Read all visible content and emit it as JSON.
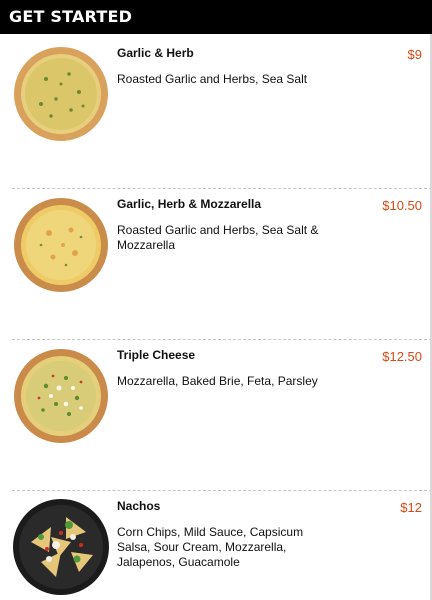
{
  "header": {
    "title": "GET STARTED"
  },
  "items": [
    {
      "name": "Garlic & Herb",
      "price": "$9",
      "description": "Roasted Garlic and Herbs, Sea Salt",
      "image_icon": "garlic-herb-pizza-icon"
    },
    {
      "name": "Garlic, Herb & Mozzarella",
      "price": "$10.50",
      "description": "Roasted Garlic and Herbs, Sea Salt & Mozzarella",
      "image_icon": "garlic-herb-mozzarella-pizza-icon"
    },
    {
      "name": "Triple Cheese",
      "price": "$12.50",
      "description": "Mozzarella, Baked Brie, Feta, Parsley",
      "image_icon": "triple-cheese-pizza-icon"
    },
    {
      "name": "Nachos",
      "price": "$12",
      "description": "Corn Chips, Mild Sauce, Capsicum Salsa, Sour Cream, Mozzarella, Jalapenos, Guacamole",
      "image_icon": "nachos-icon"
    }
  ],
  "colors": {
    "header_bg": "#000000",
    "price": "#d44a14"
  }
}
